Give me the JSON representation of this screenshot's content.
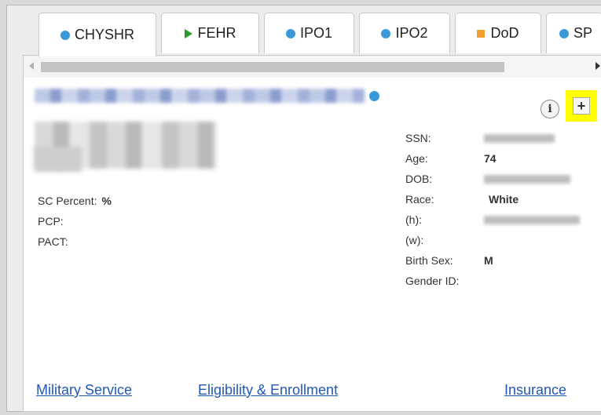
{
  "tabs": [
    {
      "label": "CHYSHR",
      "icon": "dot-icon",
      "color": "#3a9ad9"
    },
    {
      "label": "FEHR",
      "icon": "play-icon",
      "color": "#2a9a2a"
    },
    {
      "label": "IPO1",
      "icon": "dot-icon",
      "color": "#3a9ad9"
    },
    {
      "label": "IPO2",
      "icon": "dot-icon",
      "color": "#3a9ad9"
    },
    {
      "label": "DoD",
      "icon": "square-icon",
      "color": "#f0a030"
    },
    {
      "label": "SP",
      "icon": "dot-icon",
      "color": "#3a9ad9"
    }
  ],
  "buttons": {
    "info_label": "i",
    "add_label": "+"
  },
  "left_fields": {
    "sc_percent_label": "SC Percent:",
    "sc_percent_value": "%",
    "pcp_label": "PCP:",
    "pact_label": "PACT:"
  },
  "right_fields": {
    "ssn_label": "SSN:",
    "age_label": "Age:",
    "age_value": "74",
    "dob_label": "DOB:",
    "race_label": "Race:",
    "race_value": "White",
    "home_phone_label": "(h):",
    "work_phone_label": "(w):",
    "birth_sex_label": "Birth Sex:",
    "birth_sex_value": "M",
    "gender_id_label": "Gender ID:"
  },
  "links": {
    "military": "Military Service",
    "eligibility": "Eligibility & Enrollment",
    "insurance": "Insurance"
  },
  "colors": {
    "highlight": "#ffff00",
    "link": "#2258b5",
    "status_dot": "#3a9ad9"
  }
}
